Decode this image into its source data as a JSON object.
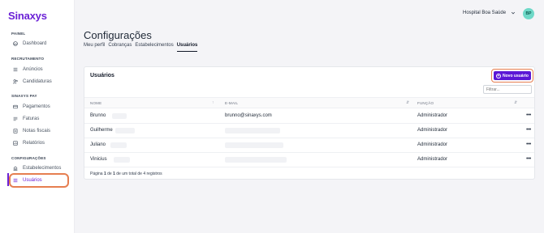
{
  "app": {
    "logo": "Sinaxys"
  },
  "sidebar": {
    "sections": [
      {
        "title": "PAINEL",
        "items": [
          {
            "label": "Dashboard",
            "icon": "dashboard-icon"
          }
        ]
      },
      {
        "title": "RECRUTAMENTO",
        "items": [
          {
            "label": "Anúncios",
            "icon": "list-icon"
          },
          {
            "label": "Candidaturas",
            "icon": "people-icon"
          }
        ]
      },
      {
        "title": "SINAXYS PAY",
        "items": [
          {
            "label": "Pagamentos",
            "icon": "payment-icon"
          },
          {
            "label": "Faturas",
            "icon": "invoice-icon"
          },
          {
            "label": "Notas fiscais",
            "icon": "document-icon"
          },
          {
            "label": "Relatórios",
            "icon": "report-icon"
          }
        ]
      },
      {
        "title": "CONFIGURAÇÕES",
        "items": [
          {
            "label": "Estabelecimentos",
            "icon": "building-icon"
          },
          {
            "label": "Usuários",
            "icon": "users-icon",
            "active": true
          }
        ]
      }
    ]
  },
  "header": {
    "hospital": "Hospital Boa Saúde",
    "avatar_initials": "BP"
  },
  "page": {
    "title": "Configurações",
    "tabs": [
      "Meu perfil",
      "Cobranças",
      "Estabelecimentos",
      "Usuários"
    ],
    "active_tab": "Usuários"
  },
  "card": {
    "title": "Usuários",
    "new_button": "Novo usuário",
    "filter_placeholder": "Filtrar...",
    "columns": [
      "NOME",
      "E-MAIL",
      "FUNÇÃO"
    ],
    "rows": [
      {
        "name": "Brunno",
        "email": "brunno@sinaxys.com",
        "role": "Administrador"
      },
      {
        "name": "Guilherme",
        "email": "",
        "role": "Administrador"
      },
      {
        "name": "Juliano",
        "email": "",
        "role": "Administrador"
      },
      {
        "name": "Vinicius",
        "email": "",
        "role": "Administrador"
      }
    ],
    "footer": {
      "prefix": "Página",
      "page": "1",
      "of": "de",
      "pages": "1",
      "suffix": "de um total de 4 registros"
    }
  },
  "colors": {
    "brand": "#6b21d6",
    "button": "#5b17d6",
    "highlight": "#e67e50",
    "avatar": "#6fd9c8"
  }
}
